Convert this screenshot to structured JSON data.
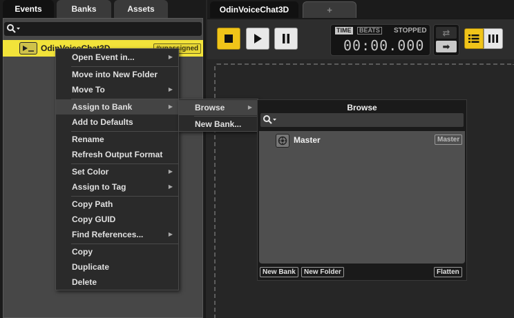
{
  "left_tabs": [
    {
      "label": "Events"
    },
    {
      "label": "Banks"
    },
    {
      "label": "Assets"
    }
  ],
  "event": {
    "name": "OdinVoiceChat3D",
    "badge": "#unassigned"
  },
  "right_tabs": {
    "active": "OdinVoiceChat3D",
    "add": "+"
  },
  "transport": {
    "time_label": "TIME",
    "beats_label": "BEATS",
    "status": "STOPPED",
    "timecode": "00:00.000"
  },
  "context_menu": {
    "items": [
      {
        "label": "Open Event in...",
        "submenu": true
      },
      {
        "label": "Move into New Folder",
        "submenu": false
      },
      {
        "label": "Move To",
        "submenu": true
      },
      {
        "label": "Assign to Bank",
        "submenu": true,
        "active": true
      },
      {
        "label": "Add to Defaults",
        "submenu": false
      },
      {
        "label": "Rename",
        "submenu": false
      },
      {
        "label": "Refresh Output Format",
        "submenu": false
      },
      {
        "label": "Set Color",
        "submenu": true
      },
      {
        "label": "Assign to Tag",
        "submenu": true
      },
      {
        "label": "Copy Path",
        "submenu": false
      },
      {
        "label": "Copy GUID",
        "submenu": false
      },
      {
        "label": "Find References...",
        "submenu": true
      },
      {
        "label": "Copy",
        "submenu": false
      },
      {
        "label": "Duplicate",
        "submenu": false
      },
      {
        "label": "Delete",
        "submenu": false
      }
    ]
  },
  "sub_menu": {
    "items": [
      {
        "label": "Browse",
        "submenu": true,
        "active": true
      },
      {
        "label": "New Bank...",
        "submenu": false
      }
    ]
  },
  "browse_popup": {
    "title": "Browse",
    "bank": {
      "name": "Master",
      "badge": "Master"
    },
    "buttons": {
      "new_bank": "New Bank",
      "new_folder": "New Folder",
      "flatten": "Flatten"
    }
  },
  "colors": {
    "accent_yellow": "#f0c419",
    "event_highlight": "#f2e33a",
    "panel_dark": "#1b1b1b",
    "menu_bg": "#2a2a2a"
  }
}
